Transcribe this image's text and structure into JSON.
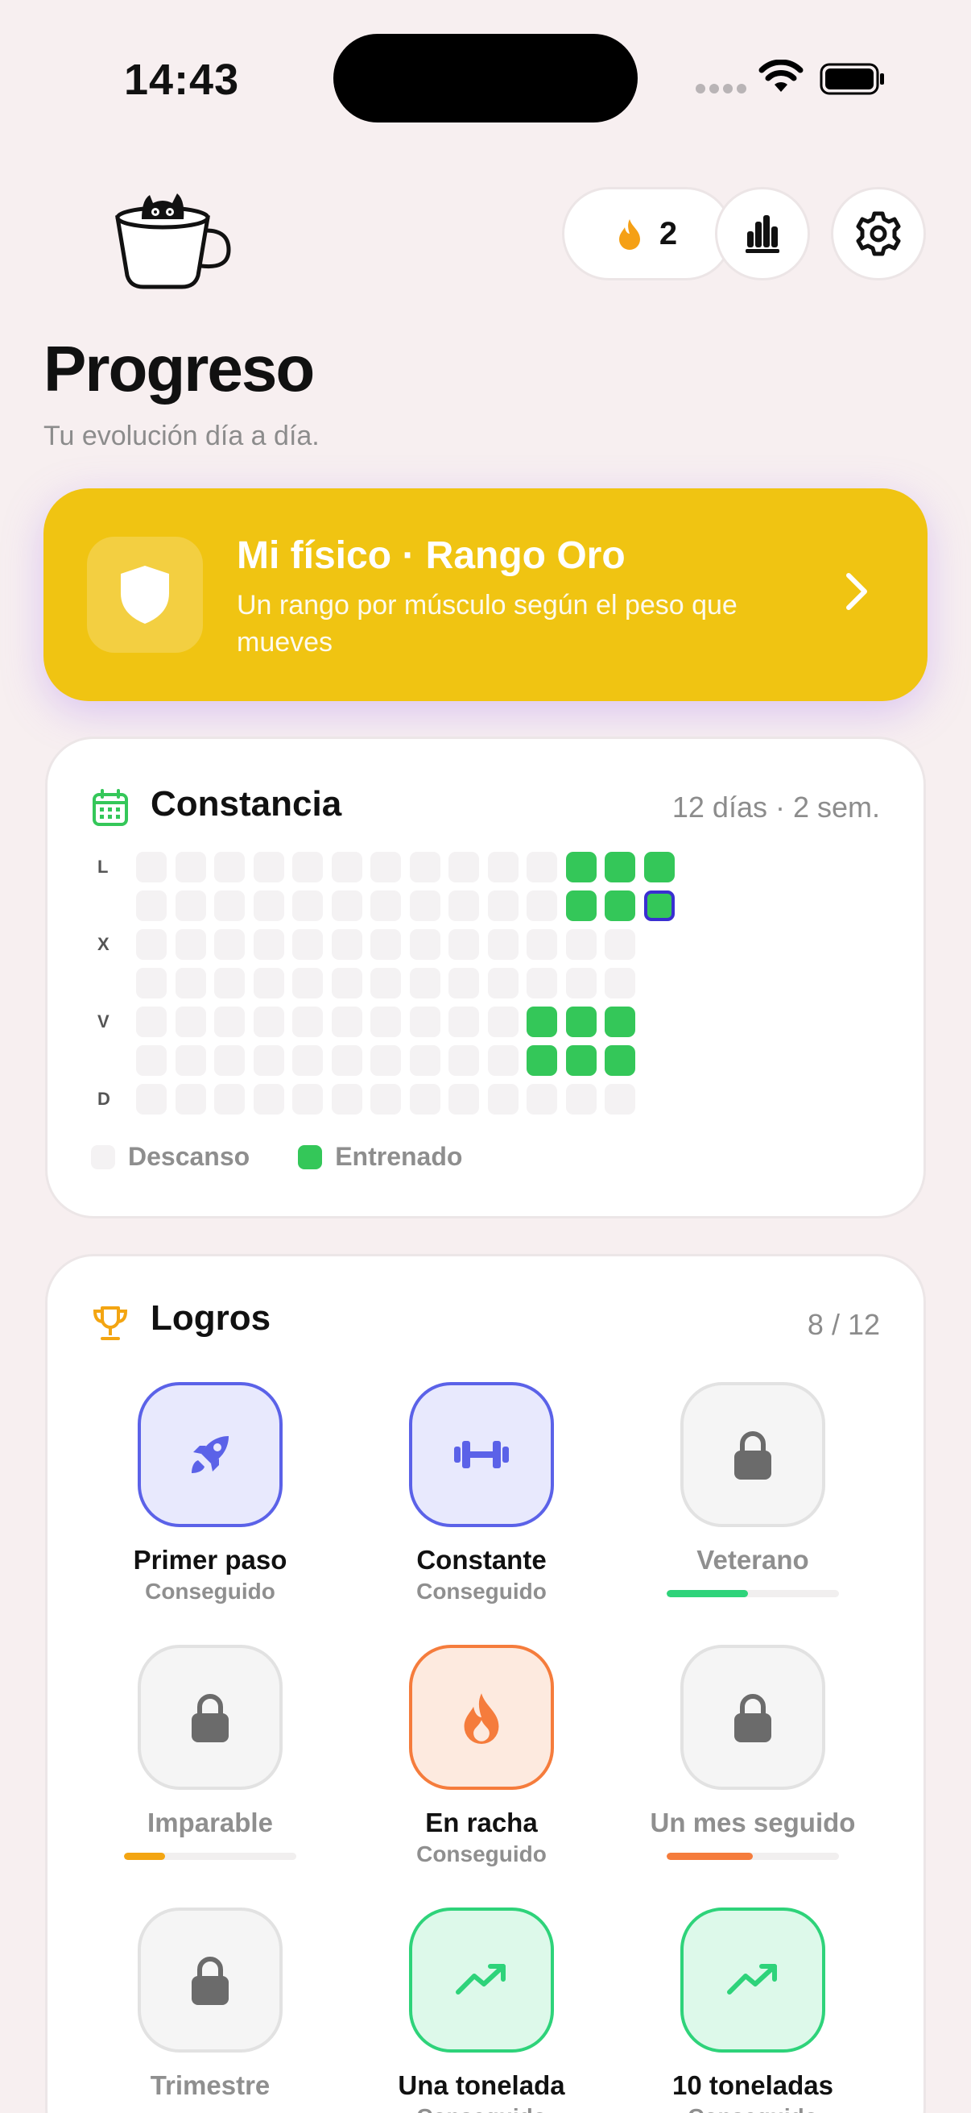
{
  "status_bar": {
    "time": "14:43"
  },
  "header": {
    "streak_count": "2"
  },
  "page": {
    "title": "Progreso",
    "subtitle": "Tu evolución día a día."
  },
  "rank_card": {
    "title": "Mi físico · Rango Oro",
    "description": "Un rango por músculo según el peso que mueves"
  },
  "consistency": {
    "title": "Constancia",
    "meta": "12 días · 2 sem.",
    "row_labels": [
      "L",
      "",
      "X",
      "",
      "V",
      "",
      "D"
    ],
    "columns": 13,
    "trained": [
      [
        0,
        11
      ],
      [
        0,
        12
      ],
      [
        0,
        13
      ],
      [
        1,
        11
      ],
      [
        1,
        12
      ],
      [
        1,
        13
      ],
      [
        4,
        10
      ],
      [
        4,
        11
      ],
      [
        4,
        12
      ],
      [
        5,
        10
      ],
      [
        5,
        11
      ],
      [
        5,
        12
      ]
    ],
    "today": [
      1,
      13
    ],
    "legend_rest": "Descanso",
    "legend_trained": "Entrenado",
    "colors": {
      "rest": "#f4f2f3",
      "trained": "#34c759",
      "today_outline": "#3a2fd1"
    }
  },
  "achievements": {
    "title": "Logros",
    "count": "8 / 12",
    "items": [
      {
        "name": "Primer paso",
        "status": "Conseguido",
        "icon": "rocket-icon",
        "achieved": true,
        "theme": "indigo"
      },
      {
        "name": "Constante",
        "status": "Conseguido",
        "icon": "dumbbell-icon",
        "achieved": true,
        "theme": "indigo"
      },
      {
        "name": "Veterano",
        "status": "",
        "icon": "lock-icon",
        "achieved": false,
        "progress": 0.47,
        "bar_color": "#2ed37a"
      },
      {
        "name": "Imparable",
        "status": "",
        "icon": "lock-icon",
        "achieved": false,
        "progress": 0.24,
        "bar_color": "#f3a512"
      },
      {
        "name": "En racha",
        "status": "Conseguido",
        "icon": "flame-icon",
        "achieved": true,
        "theme": "orange"
      },
      {
        "name": "Un mes seguido",
        "status": "",
        "icon": "lock-icon",
        "achieved": false,
        "progress": 0.5,
        "bar_color": "#f57c3c"
      },
      {
        "name": "Trimestre",
        "status": "",
        "icon": "lock-icon",
        "achieved": false
      },
      {
        "name": "Una tonelada",
        "status": "Conseguido",
        "icon": "trend-up-icon",
        "achieved": true,
        "theme": "green"
      },
      {
        "name": "10 toneladas",
        "status": "Conseguido",
        "icon": "trend-up-icon",
        "achieved": true,
        "theme": "green"
      }
    ]
  },
  "colors": {
    "accent_gold": "#f0c412",
    "achievement_indigo": "#5b62e8",
    "achievement_orange": "#f57c3c",
    "achievement_green": "#2ed37a",
    "streak_flame": "#f5a015"
  }
}
